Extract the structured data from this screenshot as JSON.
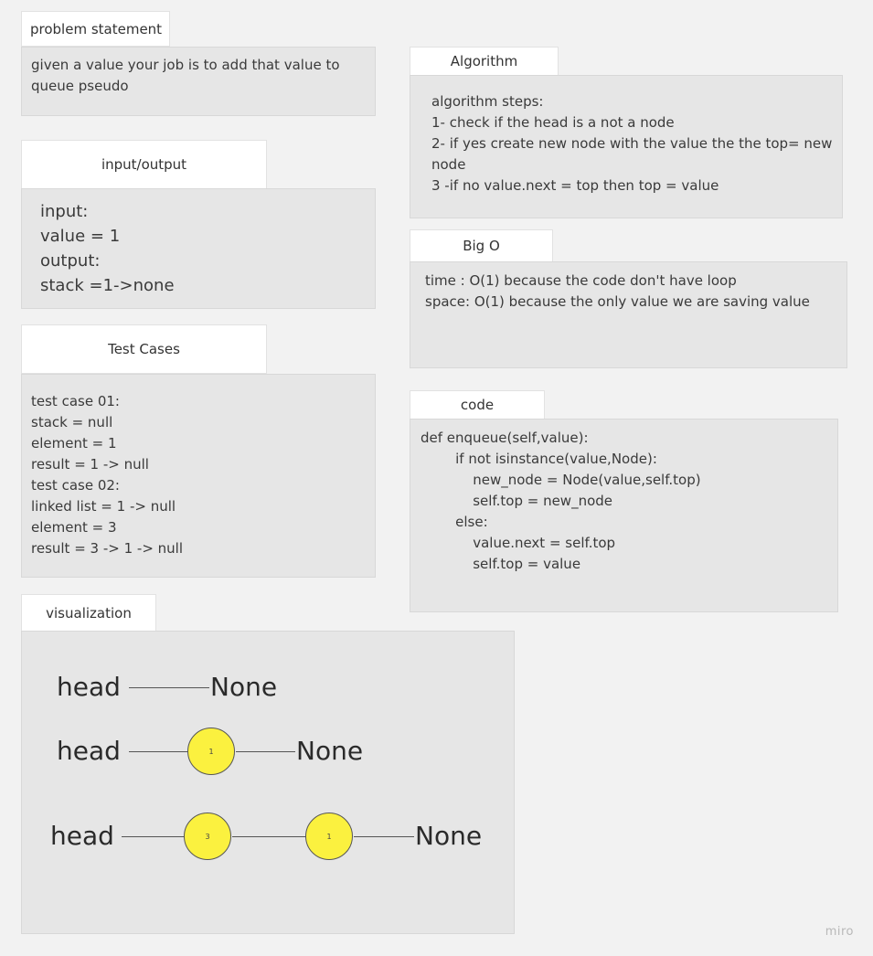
{
  "problem": {
    "title": "problem statement",
    "body": [
      "given a value your job is to add that value to",
      "queue pseudo"
    ]
  },
  "io": {
    "title": "input/output",
    "body": [
      "input:",
      "value = 1",
      "output:",
      "stack =1->none"
    ]
  },
  "tests": {
    "title": "Test Cases",
    "body": [
      "test case 01:",
      "stack = null",
      "element = 1",
      "result = 1 -> null",
      "test case 02:",
      "linked list = 1 -> null",
      "element = 3",
      "result = 3 -> 1 -> null"
    ]
  },
  "algorithm": {
    "title": "Algorithm",
    "body": [
      "algorithm steps:",
      "1- check if the head is a not a node",
      "2- if yes create new node with the value the the top= new",
      "node",
      "3 -if no value.next = top then top = value"
    ]
  },
  "bigo": {
    "title": "Big O",
    "body": [
      "time : O(1) because the code don't have loop",
      "space: O(1) because the only value we are saving value"
    ]
  },
  "code": {
    "title": "code",
    "body": [
      "def enqueue(self,value):",
      "        if not isinstance(value,Node):",
      "            new_node = Node(value,self.top)",
      "            self.top = new_node",
      "        else:",
      "            value.next = self.top",
      "            self.top = value"
    ]
  },
  "visualization": {
    "title": "visualization",
    "rows": [
      {
        "head": "head",
        "nodes": [],
        "tail": "None"
      },
      {
        "head": "head",
        "nodes": [
          "1"
        ],
        "tail": "None"
      },
      {
        "head": "head",
        "nodes": [
          "3",
          "1"
        ],
        "tail": "None"
      }
    ]
  },
  "watermark": "miro",
  "colors": {
    "background": "#f2f2f2",
    "card": "#e6e6e6",
    "node": "#fbf13f"
  }
}
